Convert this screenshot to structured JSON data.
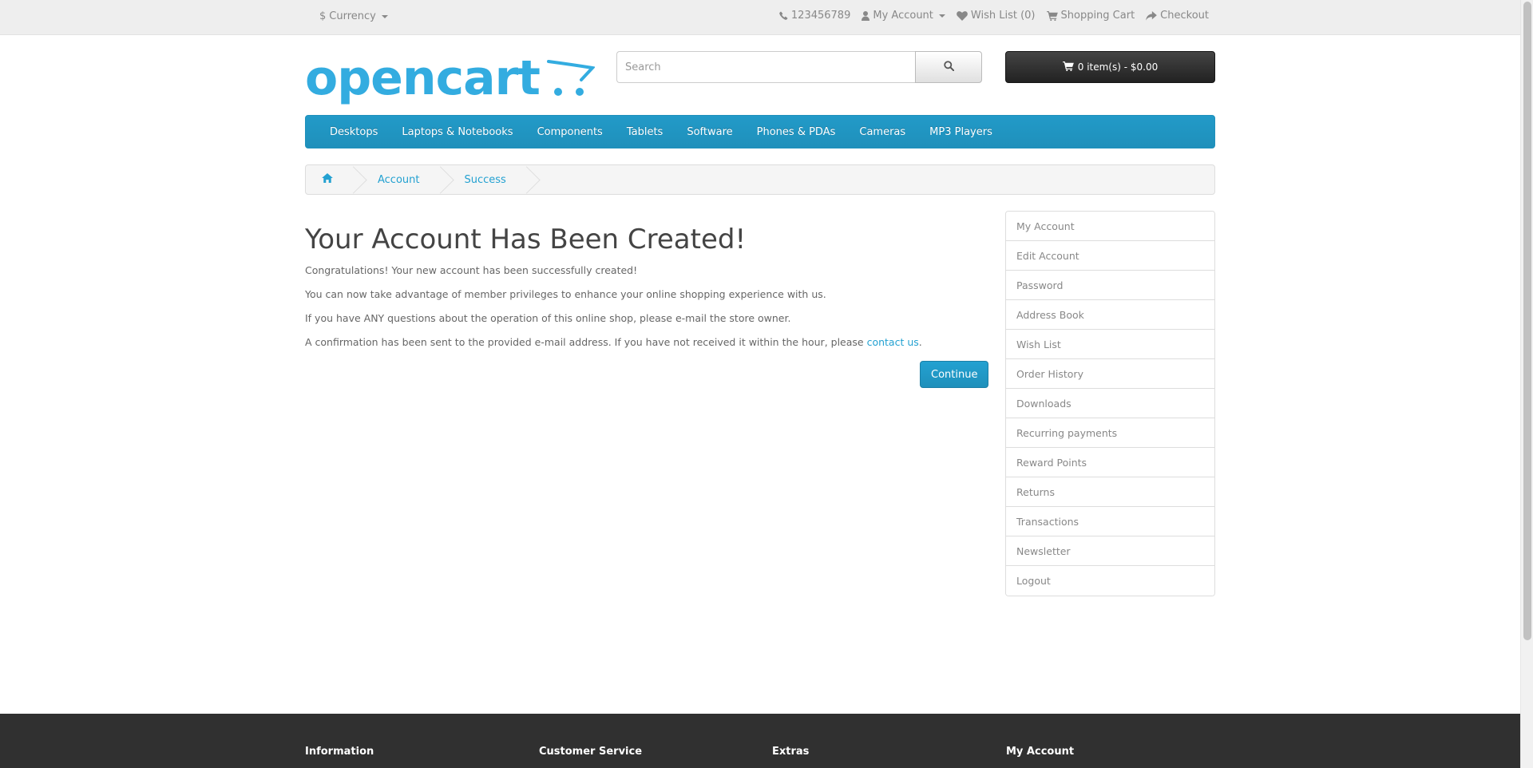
{
  "topbar": {
    "currency_symbol": "$",
    "currency_label": "Currency",
    "phone": "123456789",
    "my_account": "My Account",
    "wishlist": "Wish List (0)",
    "cart": "Shopping Cart",
    "checkout": "Checkout"
  },
  "header": {
    "logo_text": "opencart",
    "search_placeholder": "Search",
    "cart_button": "0 item(s) - $0.00"
  },
  "menu": {
    "items": [
      "Desktops",
      "Laptops & Notebooks",
      "Components",
      "Tablets",
      "Software",
      "Phones & PDAs",
      "Cameras",
      "MP3 Players"
    ]
  },
  "breadcrumb": {
    "items": [
      "Account",
      "Success"
    ]
  },
  "main": {
    "title": "Your Account Has Been Created!",
    "p1": "Congratulations! Your new account has been successfully created!",
    "p2": "You can now take advantage of member privileges to enhance your online shopping experience with us.",
    "p3": "If you have ANY questions about the operation of this online shop, please e-mail the store owner.",
    "p4_prefix": "A confirmation has been sent to the provided e-mail address. If you have not received it within the hour, please ",
    "p4_link": "contact us",
    "p4_suffix": ".",
    "continue": "Continue"
  },
  "sidebar": {
    "items": [
      "My Account",
      "Edit Account",
      "Password",
      "Address Book",
      "Wish List",
      "Order History",
      "Downloads",
      "Recurring payments",
      "Reward Points",
      "Returns",
      "Transactions",
      "Newsletter",
      "Logout"
    ]
  },
  "footer": {
    "columns": [
      "Information",
      "Customer Service",
      "Extras",
      "My Account"
    ]
  },
  "colors": {
    "accent": "#23a1d1",
    "menu": "#229ac8",
    "footer": "#303030"
  }
}
